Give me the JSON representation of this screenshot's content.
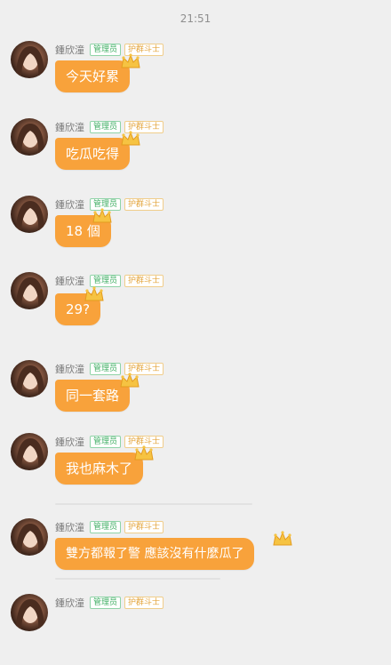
{
  "status": {
    "time": "21:51"
  },
  "messages": [
    {
      "name": "鍾欣潼",
      "tags": [
        "管理员",
        "护群斗士"
      ],
      "text": "今天好累"
    },
    {
      "name": "鍾欣潼",
      "tags": [
        "管理员",
        "护群斗士"
      ],
      "text": "吃瓜吃得"
    },
    {
      "name": "鍾欣潼",
      "tags": [
        "管理员",
        "护群斗士"
      ],
      "text": "18 個"
    },
    {
      "name": "鍾欣潼",
      "tags": [
        "管理员",
        "护群斗士"
      ],
      "text": "29?"
    },
    {
      "name": "鍾欣潼",
      "tags": [
        "管理员",
        "护群斗士"
      ],
      "text": "同一套路"
    },
    {
      "name": "鍾欣潼",
      "tags": [
        "管理员",
        "护群斗士"
      ],
      "text": "我也麻木了"
    },
    {
      "name": "鍾欣潼",
      "tags": [
        "管理员",
        "护群斗士"
      ],
      "text": "雙方都報了警 應該沒有什麼瓜了"
    },
    {
      "name": "鍾欣潼",
      "tags": [
        "管理员",
        "护群斗士"
      ],
      "text": ""
    }
  ],
  "colors": {
    "bubble": "#f8a23b",
    "admin_tag": "#3fae63",
    "fighter_tag": "#e3a43c",
    "background": "#efefef"
  },
  "icons": {
    "bubble_decoration": "crown-icon"
  }
}
